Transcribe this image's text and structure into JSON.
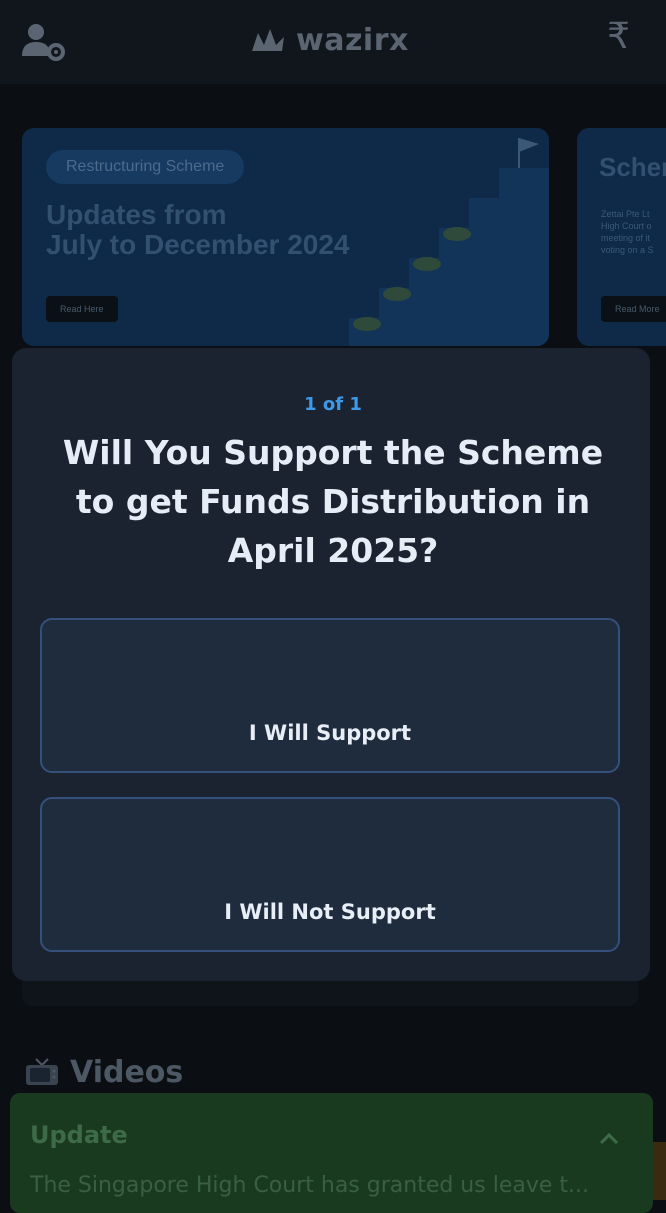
{
  "header": {
    "brand": "wazirx",
    "currency_symbol": "₹"
  },
  "banners": [
    {
      "pill": "Restructuring Scheme",
      "title_line1": "Updates from",
      "title_line2": "July to December 2024",
      "button": "Read Here"
    },
    {
      "title": "Scher",
      "body_lines": [
        "Zettai Pte Lt",
        "High Court o",
        "meeting of it",
        "voting on a S"
      ],
      "button": "Read More"
    }
  ],
  "modal": {
    "counter": "1 of 1",
    "question": "Will You Support the Scheme to get Funds Distribution in April 2025?",
    "options": [
      {
        "label": "I Will Support"
      },
      {
        "label": "I Will Not Support"
      }
    ]
  },
  "videos": {
    "title": "Videos",
    "icon": "tv-icon"
  },
  "update": {
    "title": "Update",
    "text": "The Singapore High Court has granted us leave t..."
  },
  "colors": {
    "background": "#0b0f14",
    "modal": "#1b2330",
    "accent": "#3d9ae8",
    "option_border": "#35507a",
    "update_panel": "#1a3a20"
  }
}
